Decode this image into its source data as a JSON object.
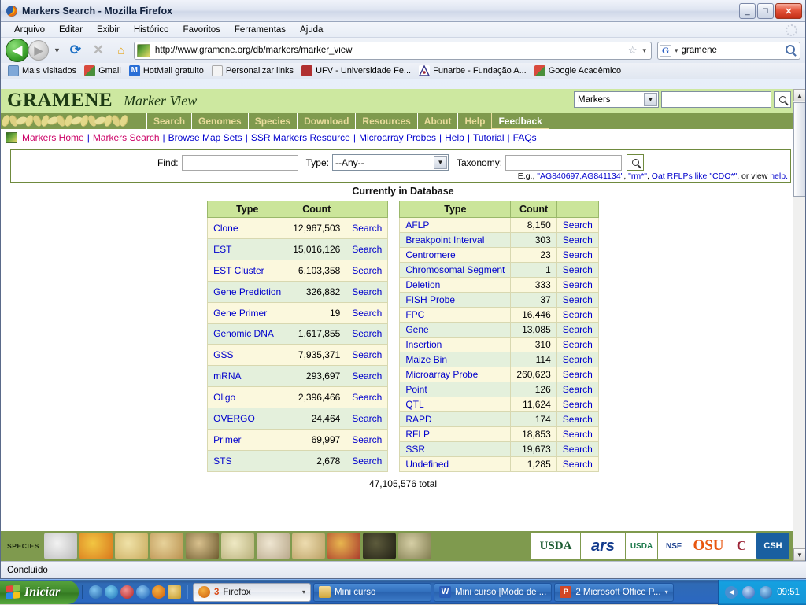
{
  "window": {
    "title": "Markers Search - Mozilla Firefox",
    "minimize": "_",
    "maximize": "□",
    "close": "✕"
  },
  "menubar": [
    {
      "label": "Arquivo",
      "accel": "A"
    },
    {
      "label": "Editar",
      "accel": "E"
    },
    {
      "label": "Exibir",
      "accel": "x"
    },
    {
      "label": "Histórico",
      "accel": "H"
    },
    {
      "label": "Favoritos",
      "accel": "v"
    },
    {
      "label": "Ferramentas",
      "accel": "F"
    },
    {
      "label": "Ajuda",
      "accel": "u"
    }
  ],
  "toolbar": {
    "back_icon": "◀",
    "forward_icon": "▶",
    "history_dropdown": "▼",
    "reload_icon": "⟳",
    "stop_icon": "✕",
    "home_icon": "⌂",
    "url": "http://www.gramene.org/db/markers/marker_view",
    "star_icon": "☆",
    "url_dropdown": "▾",
    "search_engine": "G",
    "search_dropdown": "▾",
    "search_query": "gramene",
    "search_icon": "search-icon"
  },
  "bookmarks": [
    {
      "label": "Mais visitados",
      "color": "#7fa8d8"
    },
    {
      "label": "Gmail",
      "color": "#d94a3d"
    },
    {
      "label": "HotMail gratuito",
      "color": "#2a6fd6"
    },
    {
      "label": "Personalizar links",
      "color": "#e8e8e8"
    },
    {
      "label": "UFV - Universidade Fe...",
      "color": "#b03030"
    },
    {
      "label": "Funarbe - Fundação A...",
      "color": "#3a3a8c"
    },
    {
      "label": "Google Acadêmico",
      "color": "#d94a3d"
    }
  ],
  "site": {
    "logo": "GRAMENE",
    "subtitle": "Marker View",
    "search_select": "Markers",
    "search_select_arrow": "▼",
    "search_value": "",
    "search_button_icon": "search-icon",
    "nav": [
      {
        "label": "Search",
        "active": false
      },
      {
        "label": "Genomes",
        "active": false
      },
      {
        "label": "Species",
        "active": false
      },
      {
        "label": "Download",
        "active": false
      },
      {
        "label": "Resources",
        "active": false
      },
      {
        "label": "About",
        "active": false
      },
      {
        "label": "Help",
        "active": false
      },
      {
        "label": "Feedback",
        "active": true
      }
    ],
    "subnav": [
      {
        "label": "Markers Home",
        "style": "magenta"
      },
      {
        "label": "Markers Search",
        "style": "magenta"
      },
      {
        "label": "Browse Map Sets",
        "style": "blue"
      },
      {
        "label": "SSR Markers Resource",
        "style": "blue"
      },
      {
        "label": "Microarray Probes",
        "style": "blue"
      },
      {
        "label": "Help",
        "style": "blue"
      },
      {
        "label": "Tutorial",
        "style": "blue"
      },
      {
        "label": "FAQs",
        "style": "blue"
      }
    ],
    "subnav_separator": "|"
  },
  "find_form": {
    "find_label": "Find:",
    "find_value": "",
    "type_label": "Type:",
    "type_value": "--Any--",
    "type_arrow": "▼",
    "taxonomy_label": "Taxonomy:",
    "taxonomy_value": "",
    "go_icon": "search-icon",
    "example_prefix": "E.g., ",
    "example_link1": "\"AG840697,AG841134\"",
    "example_sep1": ", ",
    "example_link2": "\"rm*\"",
    "example_sep2": ", ",
    "example_link3": "Oat RFLPs like \"CDO*\"",
    "example_suffix": ", or view ",
    "example_help": "help."
  },
  "database": {
    "title": "Currently in Database",
    "col_type": "Type",
    "col_count": "Count",
    "action_label": "Search",
    "total": "47,105,576 total",
    "left_rows": [
      {
        "type": "Clone",
        "count": "12,967,503"
      },
      {
        "type": "EST",
        "count": "15,016,126"
      },
      {
        "type": "EST Cluster",
        "count": "6,103,358"
      },
      {
        "type": "Gene Prediction",
        "count": "326,882"
      },
      {
        "type": "Gene Primer",
        "count": "19"
      },
      {
        "type": "Genomic DNA",
        "count": "1,617,855"
      },
      {
        "type": "GSS",
        "count": "7,935,371"
      },
      {
        "type": "mRNA",
        "count": "293,697"
      },
      {
        "type": "Oligo",
        "count": "2,396,466"
      },
      {
        "type": "OVERGO",
        "count": "24,464"
      },
      {
        "type": "Primer",
        "count": "69,997"
      },
      {
        "type": "STS",
        "count": "2,678"
      }
    ],
    "right_rows": [
      {
        "type": "AFLP",
        "count": "8,150"
      },
      {
        "type": "Breakpoint Interval",
        "count": "303"
      },
      {
        "type": "Centromere",
        "count": "23"
      },
      {
        "type": "Chromosomal Segment",
        "count": "1"
      },
      {
        "type": "Deletion",
        "count": "333"
      },
      {
        "type": "FISH Probe",
        "count": "37"
      },
      {
        "type": "FPC",
        "count": "16,446"
      },
      {
        "type": "Gene",
        "count": "13,085"
      },
      {
        "type": "Insertion",
        "count": "310"
      },
      {
        "type": "Maize Bin",
        "count": "114"
      },
      {
        "type": "Microarray Probe",
        "count": "260,623"
      },
      {
        "type": "Point",
        "count": "126"
      },
      {
        "type": "QTL",
        "count": "11,624"
      },
      {
        "type": "RAPD",
        "count": "174"
      },
      {
        "type": "RFLP",
        "count": "18,853"
      },
      {
        "type": "SSR",
        "count": "19,673"
      },
      {
        "type": "Undefined",
        "count": "1,285"
      }
    ]
  },
  "footer": {
    "species_label": "SPECIES",
    "logos": [
      {
        "name": "USDA",
        "text": "USDA",
        "bg": "#ffffff",
        "fg": "#1d5c33"
      },
      {
        "name": "ars",
        "text": "ars",
        "bg": "#ffffff",
        "fg": "#123a8c"
      },
      {
        "name": "USDA CSREES",
        "text": "USDA",
        "bg": "#ffffff",
        "fg": "#1d7a4c"
      },
      {
        "name": "NSF",
        "text": "NSF",
        "bg": "#ffffff",
        "fg": "#1a3f8f"
      },
      {
        "name": "OSU",
        "text": "OSU",
        "bg": "#ffffff",
        "fg": "#e8560f"
      },
      {
        "name": "Cornell",
        "text": "C",
        "bg": "#ffffff",
        "fg": "#9b2335"
      },
      {
        "name": "CSHL",
        "text": "CSH",
        "bg": "#1a5fa0",
        "fg": "#ffffff"
      }
    ],
    "scroll_down_icon": "▼"
  },
  "statusbar": {
    "text": "Concluído"
  },
  "taskbar": {
    "start_label": "Iniciar",
    "quicklaunch": [
      {
        "name": "internet-explorer-icon",
        "color": "#2b6fc4"
      },
      {
        "name": "outlook-express-icon",
        "color": "#1d7ac4"
      },
      {
        "name": "media-player-icon",
        "color": "#cc2b2b"
      },
      {
        "name": "realplayer-icon",
        "color": "#2b7ecc"
      },
      {
        "name": "firefox-icon",
        "color": "#e8700f"
      },
      {
        "name": "show-desktop-icon",
        "color": "#d4a73a"
      }
    ],
    "tasks": [
      {
        "label": "Firefox",
        "count": "3",
        "icon_color": "#e8700f",
        "active": true,
        "arrow": "▾"
      },
      {
        "label": "Mini curso",
        "count": "",
        "icon_color": "#d4a73a",
        "active": false,
        "arrow": ""
      },
      {
        "label": "Mini curso [Modo de ...",
        "count": "",
        "icon_color": "#2b5eb8",
        "active": false,
        "arrow": ""
      },
      {
        "label": "2 Microsoft Office P...",
        "count": "2",
        "icon_color": "#d24726",
        "active": false,
        "arrow": "▾"
      }
    ],
    "tray": {
      "expand_icon": "◀",
      "network_icon": "network-icon",
      "messenger_icon": "messenger-icon",
      "clock": "09:51"
    }
  }
}
